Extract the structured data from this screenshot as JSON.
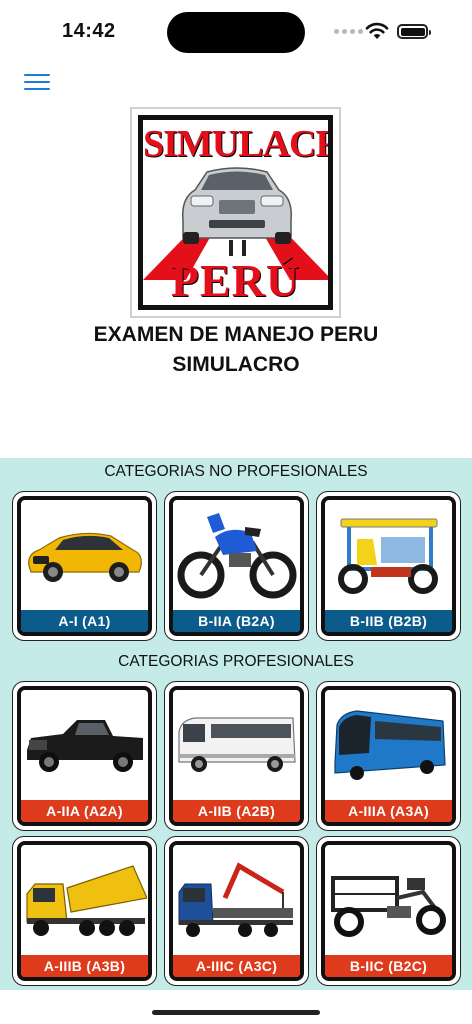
{
  "status_bar": {
    "time": "14:42"
  },
  "logo": {
    "top_text": "SIMULACRO",
    "bottom_text": "PERÚ"
  },
  "app": {
    "title_line1": "EXAMEN DE MANEJO PERU",
    "title_line2": "SIMULACRO"
  },
  "sections": {
    "non_professional": {
      "title": "CATEGORIAS NO PROFESIONALES",
      "items": [
        {
          "label": "A-I (A1)",
          "icon": "car-icon"
        },
        {
          "label": "B-IIA (B2A)",
          "icon": "motorcycle-icon"
        },
        {
          "label": "B-IIB (B2B)",
          "icon": "mototaxi-icon"
        }
      ]
    },
    "professional": {
      "title": "CATEGORIAS PROFESIONALES",
      "items": [
        {
          "label": "A-IIA (A2A)",
          "icon": "pickup-truck-icon"
        },
        {
          "label": "A-IIB (A2B)",
          "icon": "minibus-icon"
        },
        {
          "label": "A-IIIA (A3A)",
          "icon": "bus-icon"
        },
        {
          "label": "A-IIIB (A3B)",
          "icon": "dump-truck-icon"
        },
        {
          "label": "A-IIIC (A3C)",
          "icon": "crane-truck-icon"
        },
        {
          "label": "B-IIC (B2C)",
          "icon": "cargo-trike-icon"
        }
      ]
    }
  },
  "colors": {
    "accent": "#1e7bd8",
    "panel": "#c4ebe8",
    "label_blue": "#0b5c8a",
    "label_red": "#de3a1c",
    "logo_red": "#e3101b"
  }
}
